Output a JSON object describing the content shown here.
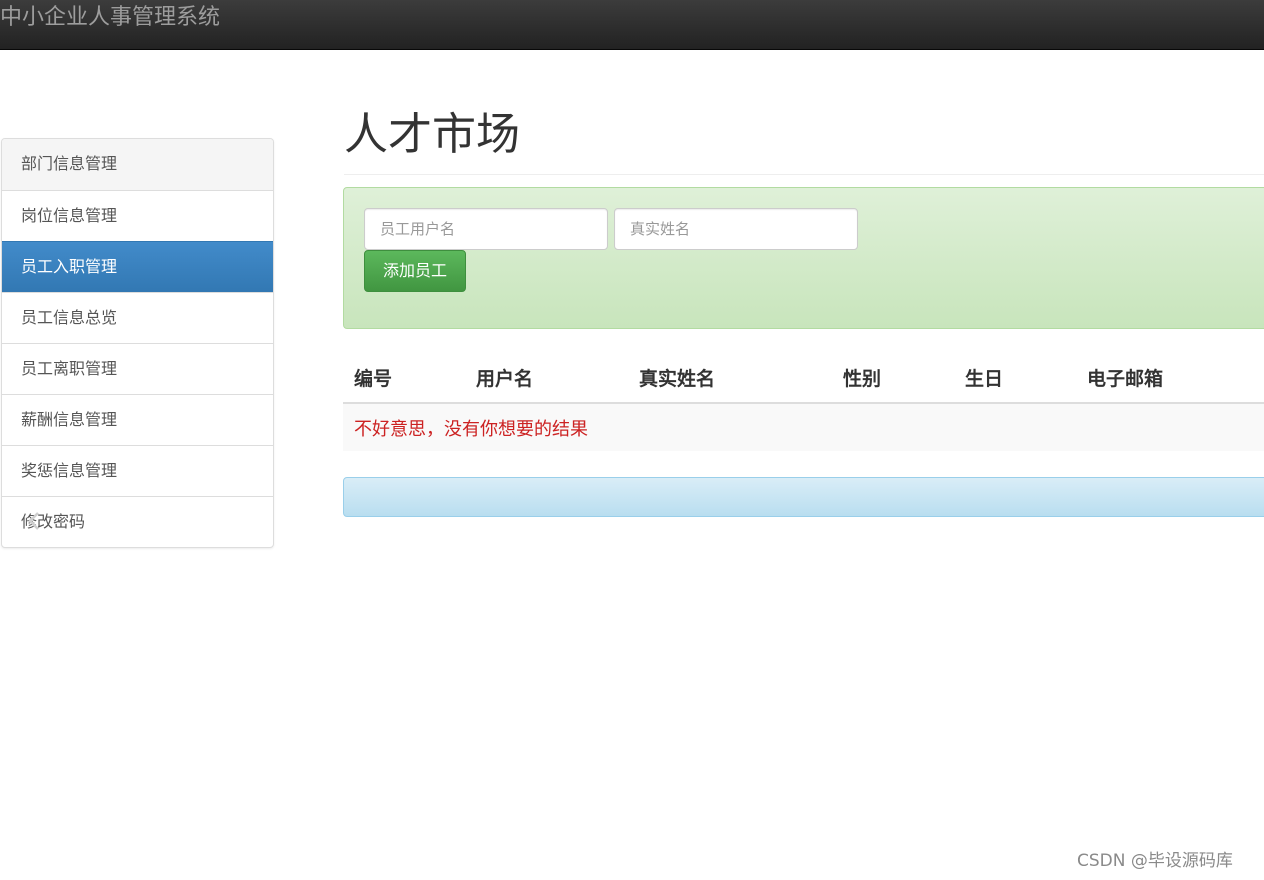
{
  "navbar": {
    "brand": "中小企业人事管理系统"
  },
  "sidebar": {
    "items": [
      {
        "label": "部门信息管理"
      },
      {
        "label": "岗位信息管理"
      },
      {
        "label": "员工入职管理",
        "active": true
      },
      {
        "label": "员工信息总览"
      },
      {
        "label": "员工离职管理"
      },
      {
        "label": "薪酬信息管理"
      },
      {
        "label": "奖惩信息管理"
      },
      {
        "label": "修改密码"
      }
    ]
  },
  "main": {
    "title": "人才市场",
    "search": {
      "username_value": "",
      "username_placeholder": "员工用户名",
      "realname_value": "",
      "realname_placeholder": "真实姓名",
      "add_button_label": "添加员工"
    },
    "table": {
      "columns": [
        "编号",
        "用户名",
        "真实姓名",
        "性别",
        "生日",
        "电子邮箱"
      ],
      "empty_message": "不好意思，没有你想要的结果"
    }
  },
  "watermark": "CSDN @毕设源码库",
  "colors": {
    "navbar": "#222222",
    "active_item": "#428bca",
    "success_panel": "#dff0d8",
    "success_button": "#5cb85c",
    "info_bar": "#d9edf7",
    "empty_message": "#cc2222"
  }
}
